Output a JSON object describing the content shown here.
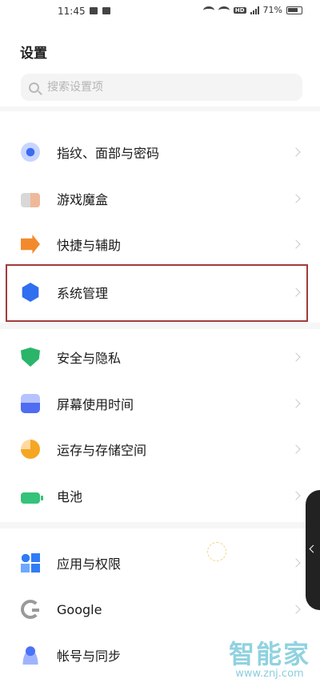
{
  "status_bar": {
    "time": "11:45",
    "battery_percent": "71%",
    "network_label": "HD"
  },
  "page": {
    "title": "设置"
  },
  "search": {
    "placeholder": "搜索设置项",
    "value": ""
  },
  "settings_items": [
    {
      "label": "指纹、面部与密码",
      "icon": "fingerprint-icon"
    },
    {
      "label": "游戏魔盒",
      "icon": "game-box-icon"
    },
    {
      "label": "快捷与辅助",
      "icon": "shortcut-icon"
    },
    {
      "label": "系统管理",
      "icon": "system-management-icon",
      "highlighted": true
    },
    {
      "label": "安全与隐私",
      "icon": "shield-icon"
    },
    {
      "label": "屏幕使用时间",
      "icon": "screen-time-icon"
    },
    {
      "label": "运存与存储空间",
      "icon": "storage-icon"
    },
    {
      "label": "电池",
      "icon": "battery-icon"
    },
    {
      "label": "应用与权限",
      "icon": "apps-icon"
    },
    {
      "label": "Google",
      "icon": "google-icon"
    },
    {
      "label": "帐号与同步",
      "icon": "account-icon"
    }
  ],
  "watermark": {
    "text": "智能家",
    "url": "www.znj.com"
  },
  "colors": {
    "highlight_border": "#a33a3a",
    "watermark": "#6cc3d6"
  }
}
